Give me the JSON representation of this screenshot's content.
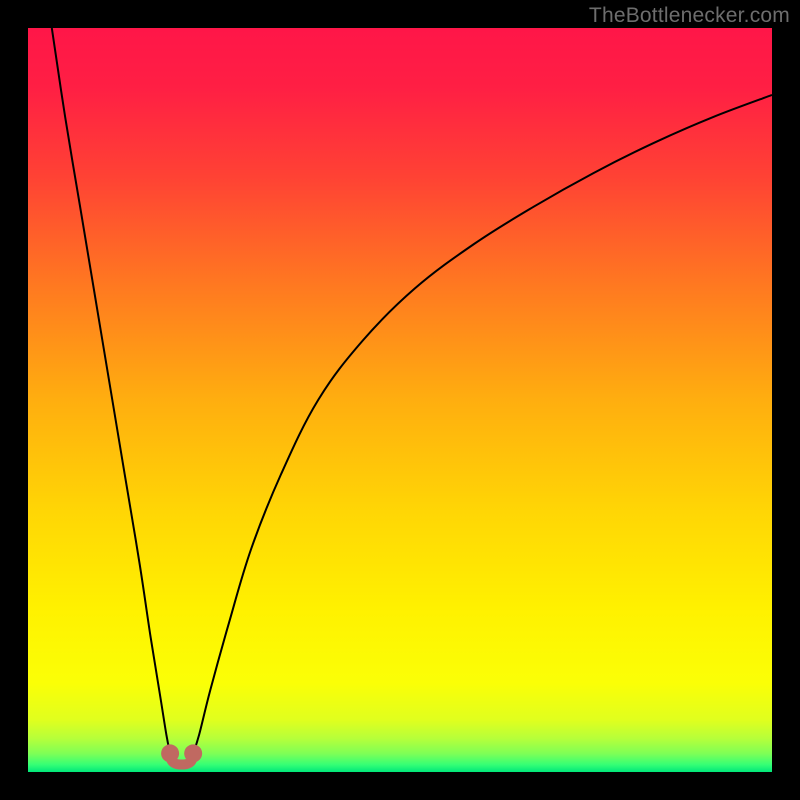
{
  "attribution": "TheBottlenecker.com",
  "chart_data": {
    "type": "line",
    "title": "",
    "xlabel": "",
    "ylabel": "",
    "xlim": [
      0,
      100
    ],
    "ylim": [
      0,
      100
    ],
    "annotations": [],
    "gradient_stops": [
      {
        "offset": 0.0,
        "color": "#ff1648"
      },
      {
        "offset": 0.08,
        "color": "#ff1f44"
      },
      {
        "offset": 0.2,
        "color": "#ff4234"
      },
      {
        "offset": 0.35,
        "color": "#ff7a20"
      },
      {
        "offset": 0.5,
        "color": "#ffae0f"
      },
      {
        "offset": 0.65,
        "color": "#ffd605"
      },
      {
        "offset": 0.78,
        "color": "#fff100"
      },
      {
        "offset": 0.88,
        "color": "#fbff06"
      },
      {
        "offset": 0.93,
        "color": "#e0ff1e"
      },
      {
        "offset": 0.955,
        "color": "#b6ff3a"
      },
      {
        "offset": 0.975,
        "color": "#7fff56"
      },
      {
        "offset": 0.99,
        "color": "#36ff75"
      },
      {
        "offset": 1.0,
        "color": "#00e77a"
      }
    ],
    "series": [
      {
        "name": "left-branch",
        "x": [
          3.2,
          5,
          7,
          9,
          11,
          13,
          15,
          16.5,
          17.8,
          18.6,
          19.1
        ],
        "y": [
          100,
          88,
          76,
          64,
          52,
          40,
          28,
          18,
          10,
          5,
          2.5
        ]
      },
      {
        "name": "right-branch",
        "x": [
          22.2,
          23,
          24.5,
          27,
          30,
          34,
          39,
          45,
          52,
          60,
          68,
          76,
          84,
          92,
          100
        ],
        "y": [
          2.5,
          5,
          11,
          20,
          30,
          40,
          50,
          58,
          65,
          71,
          76,
          80.5,
          84.5,
          88,
          91
        ]
      }
    ],
    "valley_markers": [
      {
        "name": "left-dot",
        "x": 19.1,
        "y": 2.5
      },
      {
        "name": "right-dot",
        "x": 22.2,
        "y": 2.5
      }
    ],
    "valley_arc": {
      "x0": 19.1,
      "y0": 2.5,
      "x1": 22.2,
      "y1": 2.5,
      "bottom_y": 1.0
    },
    "marker_color": "#c06961",
    "curve_color": "#000000"
  }
}
